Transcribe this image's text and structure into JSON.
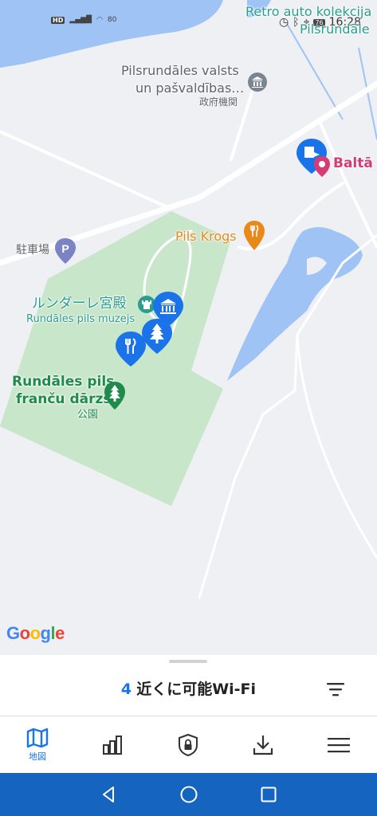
{
  "status_bar": {
    "hd_badge": "HD",
    "signal": "4G",
    "battery_small": "80",
    "battery_level": "76",
    "time": "16:28"
  },
  "map": {
    "labels": {
      "retro_auto": "Retro auto kolekcija",
      "pilsrundale": "Pilsrundāle",
      "municipality_1": "Pilsrundāles valsts",
      "municipality_2": "un pašvaldības…",
      "gov_office": "政府機関",
      "balta": "Baltā m",
      "parking": "駐車場",
      "pils_krogs": "Pils Krogs",
      "palace_jp": "ルンダーレ宮殿",
      "museum": "Rundāles pils muzejs",
      "garden_1": "Rundāles pils",
      "garden_2": "franču dārzs",
      "park": "公園"
    },
    "google_logo": [
      "G",
      "o",
      "o",
      "g",
      "l",
      "e"
    ],
    "colors": {
      "teal": "#2a9d8f",
      "orange": "#e8891c",
      "pink": "#d63c74",
      "green": "#1e8a4c",
      "pin_blue": "#1a73e8",
      "water": "#9fc3f5",
      "park": "#c8e6c9"
    }
  },
  "sheet": {
    "count": "4",
    "text": "近くに可能Wi-Fi"
  },
  "tabs": [
    {
      "icon": "map-icon",
      "label": "地図",
      "active": true
    },
    {
      "icon": "chart-icon",
      "label": ""
    },
    {
      "icon": "lock-shield-icon",
      "label": ""
    },
    {
      "icon": "download-icon",
      "label": ""
    },
    {
      "icon": "menu-icon",
      "label": ""
    }
  ],
  "nav": [
    "back-icon",
    "home-icon",
    "recents-icon"
  ]
}
